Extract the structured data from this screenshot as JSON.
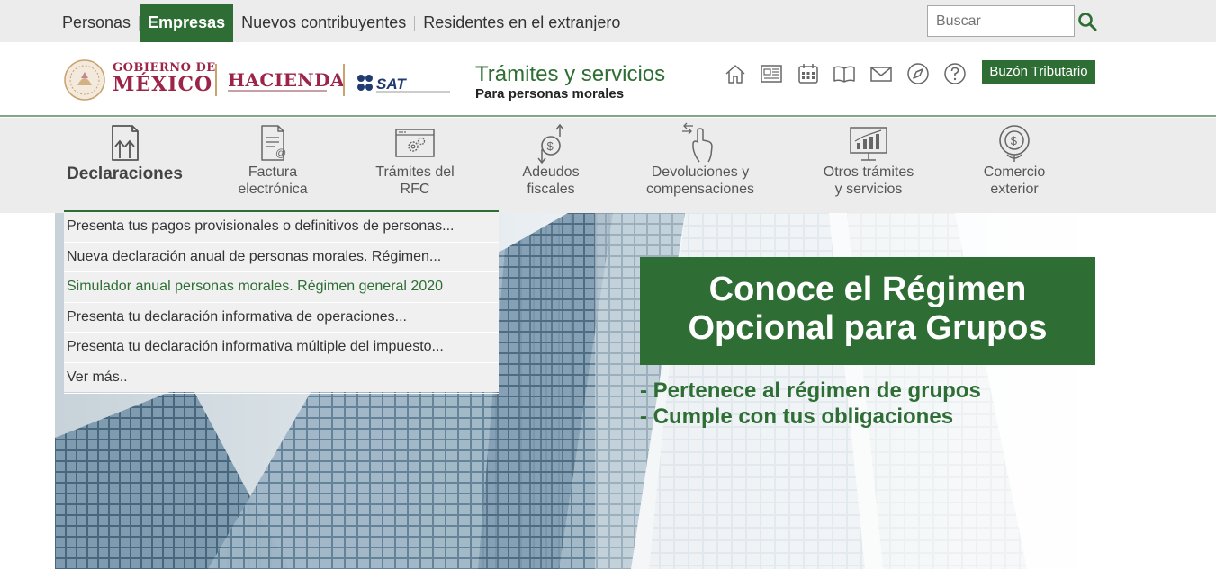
{
  "topnav": {
    "items": [
      {
        "label": "Personas",
        "active": false
      },
      {
        "label": "Empresas",
        "active": true
      },
      {
        "label": "Nuevos contribuyentes",
        "active": false
      },
      {
        "label": "Residentes en el extranjero",
        "active": false
      }
    ],
    "search_placeholder": "Buscar"
  },
  "header": {
    "logo_gobierno_line1": "GOBIERNO DE",
    "logo_gobierno_line2": "MÉXICO",
    "logo_hacienda": "HACIENDA",
    "logo_sat": "SAT",
    "title": "Trámites y servicios",
    "subtitle": "Para personas morales",
    "icons": [
      "home-icon",
      "newspaper-icon",
      "calendar-icon",
      "book-icon",
      "mail-icon",
      "compass-icon",
      "help-icon"
    ],
    "buzon_label": "Buzón Tributario"
  },
  "categories": [
    {
      "line1": "Declaraciones",
      "line2": "",
      "active": true,
      "icon": "declaraciones-icon"
    },
    {
      "line1": "Factura",
      "line2": "electrónica",
      "active": false,
      "icon": "factura-icon"
    },
    {
      "line1": "Trámites del",
      "line2": "RFC",
      "active": false,
      "icon": "rfc-icon"
    },
    {
      "line1": "Adeudos",
      "line2": "fiscales",
      "active": false,
      "icon": "adeudos-icon"
    },
    {
      "line1": "Devoluciones y",
      "line2": "compensaciones",
      "active": false,
      "icon": "devoluciones-icon"
    },
    {
      "line1": "Otros trámites",
      "line2": "y servicios",
      "active": false,
      "icon": "otros-tramites-icon"
    },
    {
      "line1": "Comercio",
      "line2": "exterior",
      "active": false,
      "icon": "comercio-icon"
    }
  ],
  "dropdown": {
    "items": [
      {
        "label": "Presenta tus pagos provisionales o definitivos de personas...",
        "highlight": false
      },
      {
        "label": "Nueva declaración anual de personas morales. Régimen...",
        "highlight": false
      },
      {
        "label": "Simulador anual personas morales. Régimen general 2020",
        "highlight": true
      },
      {
        "label": "Presenta tu declaración informativa de operaciones...",
        "highlight": false
      },
      {
        "label": "Presenta tu declaración informativa múltiple del impuesto...",
        "highlight": false
      },
      {
        "label": "Ver más..",
        "highlight": false
      }
    ]
  },
  "hero": {
    "banner_line1": "Conoce el Régimen",
    "banner_line2": "Opcional para Grupos",
    "bullet1": "- Pertenece al régimen de grupos",
    "bullet2": "- Cumple con tus obligaciones"
  },
  "colors": {
    "brand_green": "#2e6e34",
    "gob_maroon": "#9d2449",
    "gold": "#c9a26d",
    "bar_gray": "#ececec"
  }
}
